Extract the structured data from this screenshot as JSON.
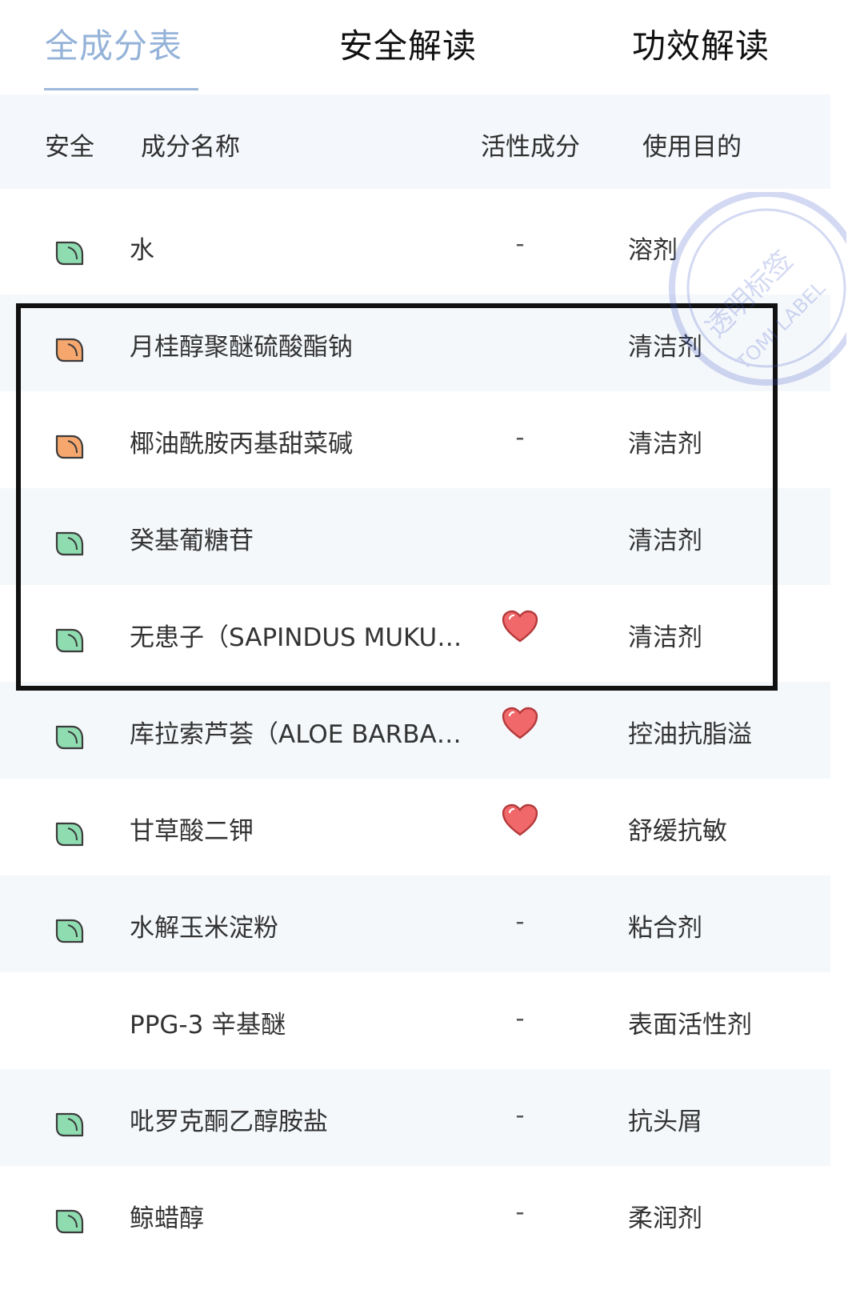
{
  "tabs": [
    {
      "label": "全成分表"
    },
    {
      "label": "安全解读"
    },
    {
      "label": "功效解读"
    }
  ],
  "header": {
    "safety": "安全",
    "name": "成分名称",
    "active": "活性成分",
    "purpose": "使用目的"
  },
  "stamp": {
    "text_cn": "透明标签",
    "text_en": "TOMI LABEL"
  },
  "colors": {
    "accent": "#95b3d8",
    "safe_green": "#8fdcb0",
    "warn_orange": "#f6a76e",
    "heart_red": "#f0686a"
  },
  "rows": [
    {
      "safety": "green",
      "name": "水",
      "active": "-",
      "purpose": "溶剂"
    },
    {
      "safety": "orange",
      "name": "月桂醇聚醚硫酸酯钠",
      "active": "",
      "purpose": "清洁剂"
    },
    {
      "safety": "orange",
      "name": "椰油酰胺丙基甜菜碱",
      "active": "-",
      "purpose": "清洁剂"
    },
    {
      "safety": "green",
      "name": "癸基葡糖苷",
      "active": "",
      "purpose": "清洁剂"
    },
    {
      "safety": "green",
      "name": "无患子（SAPINDUS MUKU…",
      "active": "heart",
      "purpose": "清洁剂"
    },
    {
      "safety": "green",
      "name": "库拉索芦荟（ALOE BARBA…",
      "active": "heart",
      "purpose": "控油抗脂溢"
    },
    {
      "safety": "green",
      "name": "甘草酸二钾",
      "active": "heart",
      "purpose": "舒缓抗敏"
    },
    {
      "safety": "green",
      "name": "水解玉米淀粉",
      "active": "-",
      "purpose": "粘合剂"
    },
    {
      "safety": "none",
      "name": "PPG-3 辛基醚",
      "active": "-",
      "purpose": "表面活性剂"
    },
    {
      "safety": "green",
      "name": "吡罗克酮乙醇胺盐",
      "active": "-",
      "purpose": "抗头屑"
    },
    {
      "safety": "green",
      "name": "鲸蜡醇",
      "active": "-",
      "purpose": "柔润剂"
    }
  ]
}
